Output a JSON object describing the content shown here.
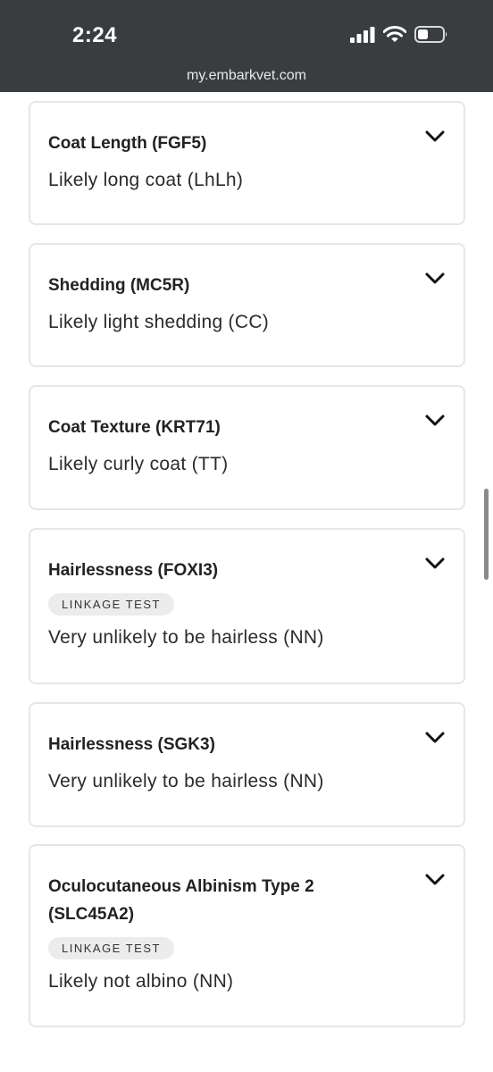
{
  "status_bar": {
    "time": "2:24",
    "url": "my.embarkvet.com"
  },
  "traits": [
    {
      "title": "Coat Length (FGF5)",
      "badge": "",
      "result": "Likely long coat (LhLh)"
    },
    {
      "title": "Shedding (MC5R)",
      "badge": "",
      "result": "Likely light shedding (CC)"
    },
    {
      "title": "Coat Texture (KRT71)",
      "badge": "",
      "result": "Likely curly coat (TT)"
    },
    {
      "title": "Hairlessness (FOXI3)",
      "badge": "LINKAGE TEST",
      "result": "Very unlikely to be hairless (NN)"
    },
    {
      "title": "Hairlessness (SGK3)",
      "badge": "",
      "result": "Very unlikely to be hairless (NN)"
    },
    {
      "title_line1": "Oculocutaneous Albinism Type 2",
      "title_line2": "(SLC45A2)",
      "badge": "LINKAGE TEST",
      "result": "Likely not albino (NN)"
    }
  ],
  "icons": {
    "chevron": "chevron-down-icon",
    "signal": "cellular-signal-icon",
    "wifi": "wifi-icon",
    "battery": "battery-icon"
  }
}
